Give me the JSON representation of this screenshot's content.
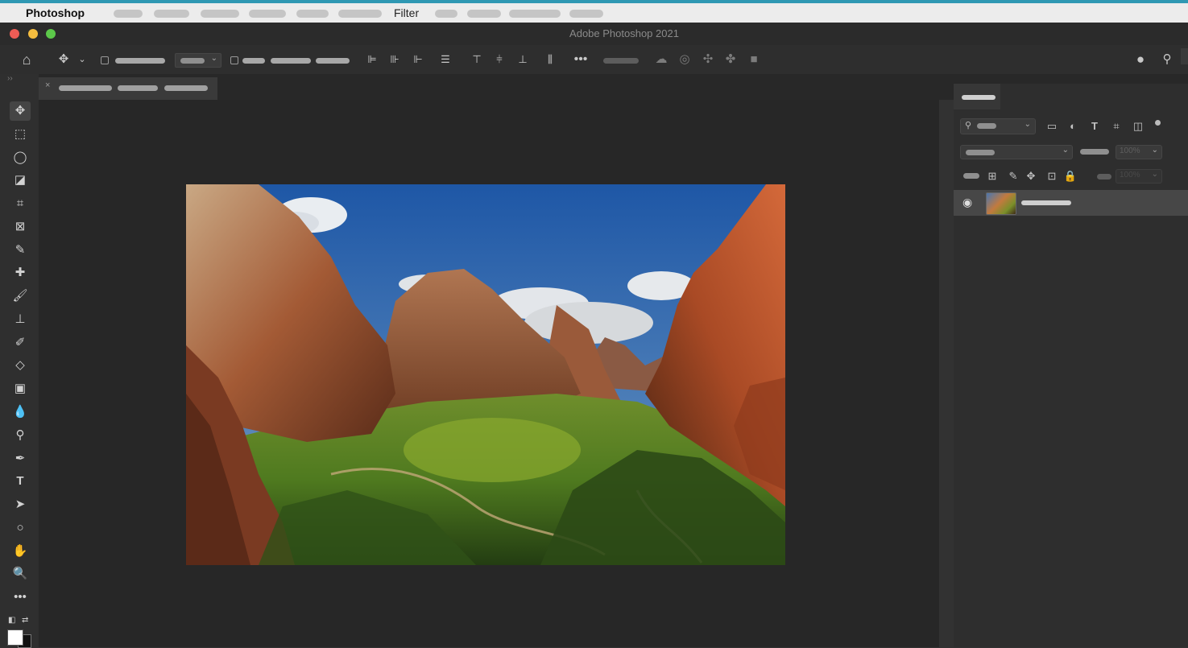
{
  "menubar": {
    "app_name": "Photoshop",
    "visible_menu": "Filter"
  },
  "window": {
    "title": "Adobe Photoshop 2021",
    "buttons": [
      "close",
      "minimize",
      "zoom"
    ]
  },
  "options_bar": {
    "icons": [
      "home-icon",
      "move-tool-icon",
      "chevron-down-icon",
      "align-left-icon",
      "align-center-icon",
      "align-right-icon",
      "distribute-icon",
      "more-icon",
      "3d-orbit-icon",
      "camera-icon",
      "user-icon",
      "search-icon"
    ]
  },
  "toolbar": {
    "tools": [
      "move",
      "marquee",
      "lasso",
      "object-selection",
      "crop",
      "frame",
      "eyedropper",
      "healing",
      "brush",
      "stamp",
      "history-brush",
      "eraser",
      "gradient",
      "blur",
      "dodge",
      "pen",
      "type",
      "path-selection",
      "ellipse",
      "hand",
      "zoom",
      "more"
    ]
  },
  "layers_panel": {
    "layer_visible": true,
    "opacity_placeholder": "100%",
    "fill_placeholder": "100%"
  },
  "colors": {
    "accent": "#2f98b3",
    "canvas_bg": "#272727",
    "panel_bg": "#2e2e2e",
    "menubar_bg": "#ececec"
  }
}
